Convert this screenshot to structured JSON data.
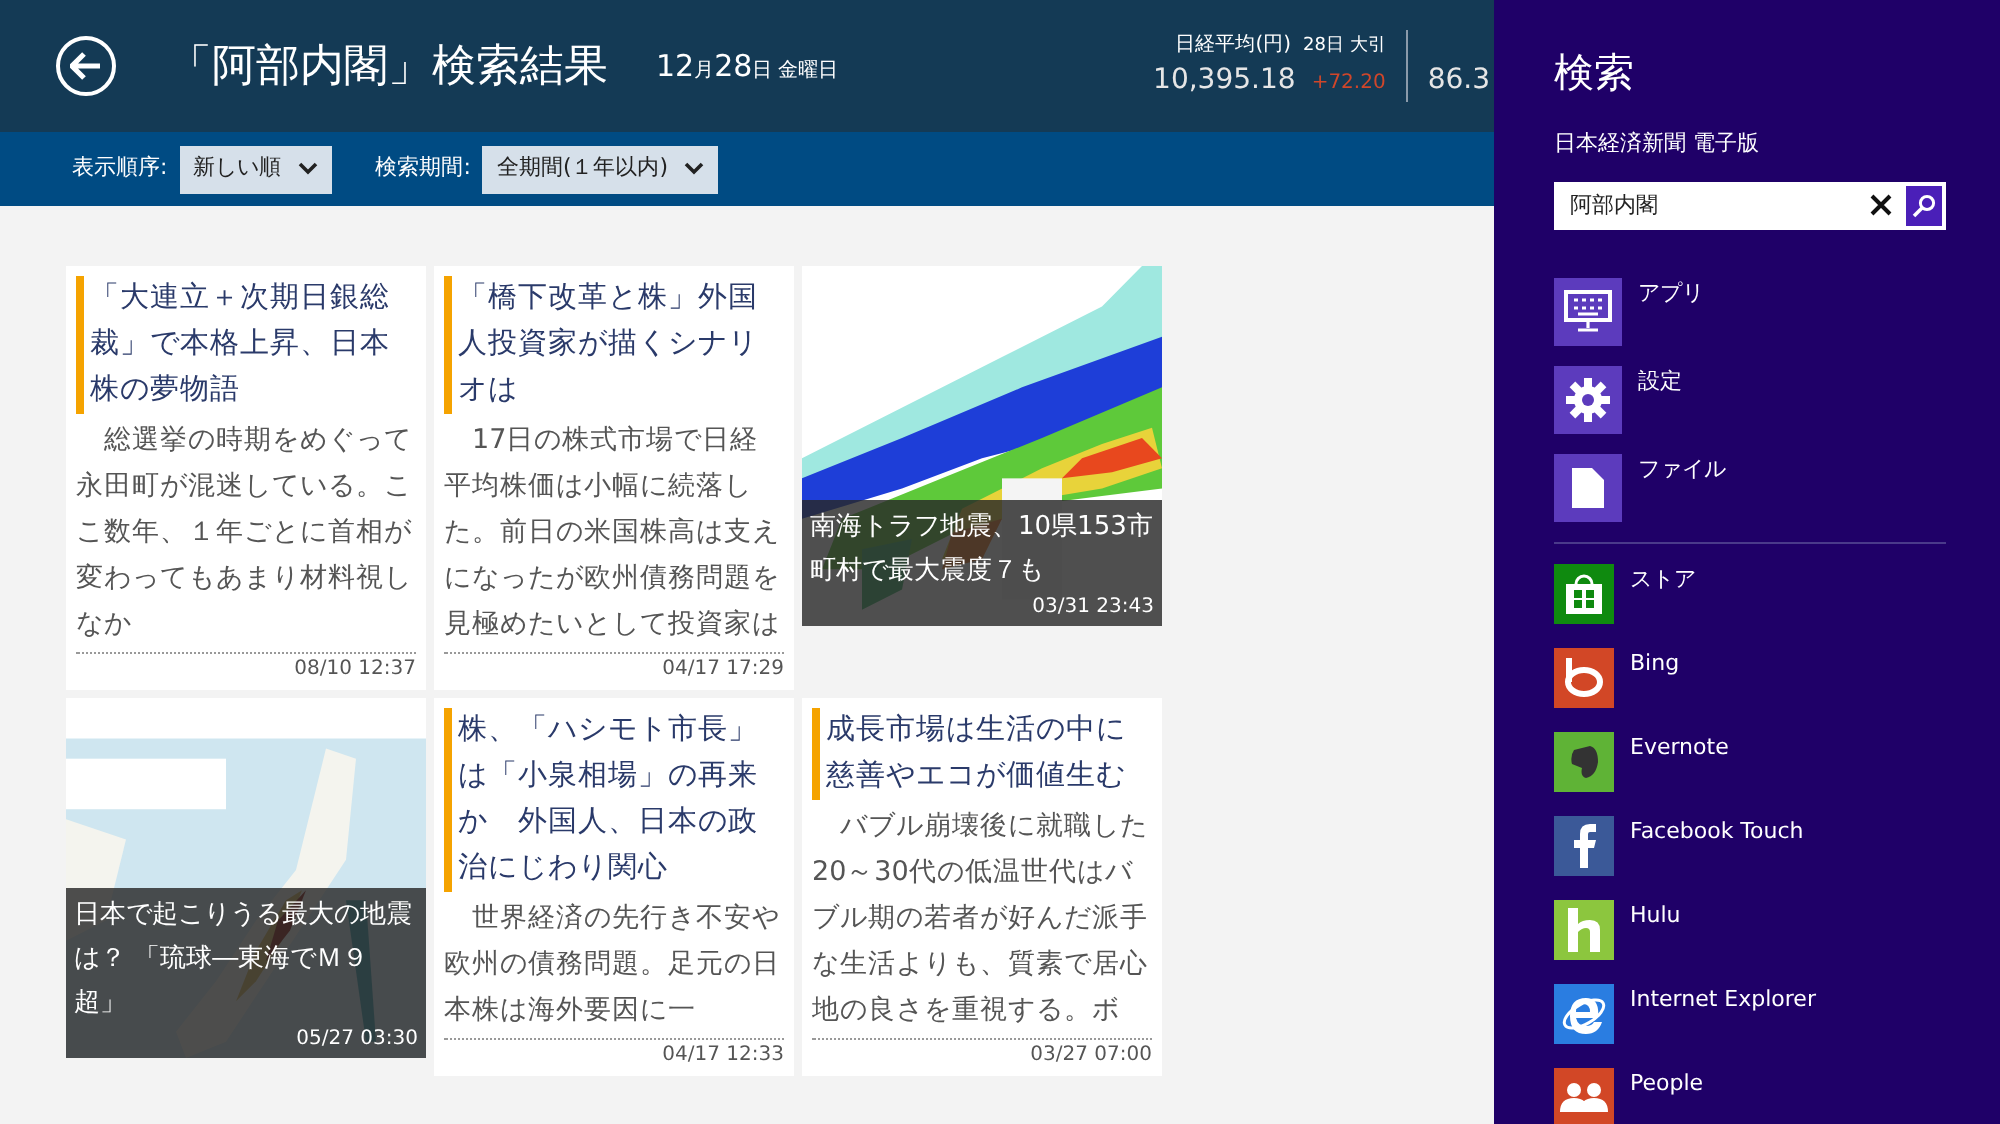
{
  "header": {
    "title": "「阿部内閣」検索結果",
    "date": {
      "month": "12",
      "month_unit": "月",
      "day": "28",
      "day_unit": "日",
      "weekday": "金曜日"
    },
    "tickers": [
      {
        "name": "日経平均(円)",
        "note": "28日 大引",
        "value": "10,395.18",
        "change": "+72.20"
      },
      {
        "value": "86.3"
      }
    ]
  },
  "filters": [
    {
      "label": "表示順序:",
      "value": "新しい順"
    },
    {
      "label": "検索期間:",
      "value": "全期間(１年以内)"
    }
  ],
  "cards": [
    {
      "kind": "article",
      "title": "「大連立＋次期日銀総裁」で本格上昇、日本株の夢物語",
      "body": "　総選挙の時期をめぐって永田町が混迷している。ここ数年、１年ごとに首相が変わってもあまり材料視しなか",
      "time": "08/10 12:37"
    },
    {
      "kind": "article",
      "title": "「橋下改革と株」外国人投資家が描くシナリオは",
      "body": "　17日の株式市場で日経平均株価は小幅に続落した。前日の米国株高は支えになったが欧州債務問題を見極めたいとして投資家は",
      "time": "04/17 17:29"
    },
    {
      "caption": "南海トラフ地震、10県153市町村で最大震度７も",
      "time": "03/31 23:43"
    },
    {
      "caption": "日本で起こりうる最大の地震は？ 「琉球―東海でＭ９超」",
      "time": "05/27 03:30"
    },
    {
      "kind": "article",
      "title": "株、「ハシモト市長」は「小泉相場」の再来か　外国人、日本の政治にじわり関心",
      "body": "　世界経済の先行き不安や欧州の債務問題。足元の日本株は海外要因に一",
      "time": "04/17 12:33"
    },
    {
      "kind": "article",
      "title": "成長市場は生活の中に慈善やエコが価値生む",
      "body": "　バブル崩壊後に就職した20～30代の低温世代はバブル期の若者が好んだ派手な生活よりも、質素で居心地の良さを重視する。ボ",
      "time": "03/27 07:00"
    }
  ],
  "search_pane": {
    "title": "検索",
    "app_name": "日本経済新聞 電子版",
    "query": "阿部内閣",
    "scopes": [
      {
        "kind": "keyboard",
        "label": "アプリ"
      },
      {
        "kind": "gear",
        "label": "設定"
      },
      {
        "kind": "file",
        "label": "ファイル"
      }
    ],
    "apps": [
      {
        "kind": "store",
        "label": "ストア",
        "color": "#0f8a0f"
      },
      {
        "kind": "bing",
        "label": "Bing",
        "color": "#d24726"
      },
      {
        "kind": "evernote",
        "label": "Evernote",
        "color": "#5fb336"
      },
      {
        "kind": "facebook",
        "label": "Facebook Touch",
        "color": "#3b5998"
      },
      {
        "kind": "hulu",
        "label": "Hulu",
        "color": "#8cc63e"
      },
      {
        "kind": "ie",
        "label": "Internet Explorer",
        "color": "#2a7de1"
      },
      {
        "kind": "people",
        "label": "People",
        "color": "#d24726"
      }
    ]
  }
}
